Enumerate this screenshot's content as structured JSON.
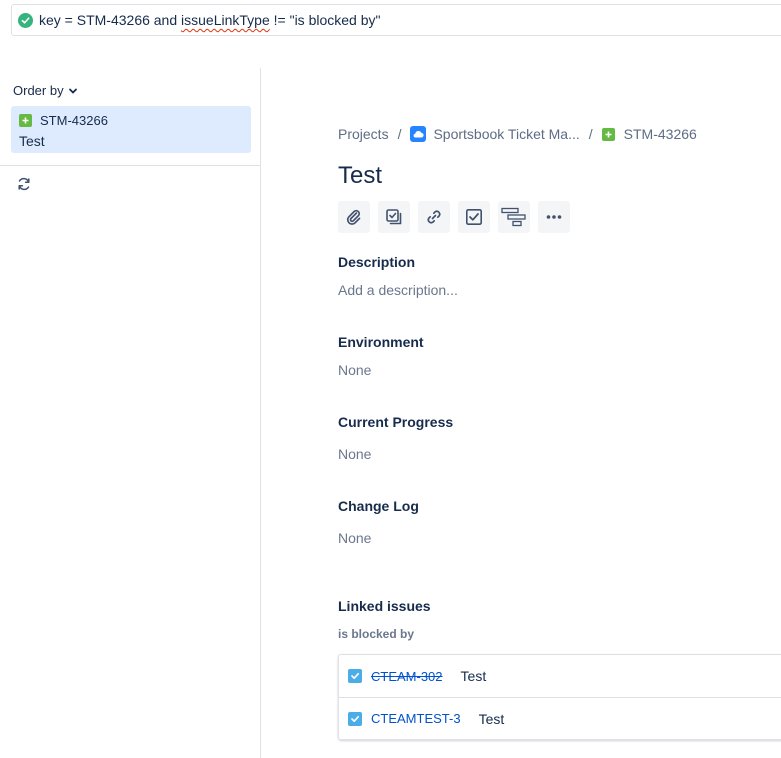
{
  "jql": {
    "prefix": "key = STM-43266 and ",
    "flagged_word": "issueLinkType",
    "suffix": " != \"is blocked by\"",
    "status": "valid",
    "status_color": "#36b37e"
  },
  "sidebar": {
    "order_by_label": "Order by",
    "issues": [
      {
        "key": "STM-43266",
        "summary": "Test",
        "type_icon": "story-icon",
        "selected": true
      }
    ],
    "refresh_icon": "refresh-icon"
  },
  "breadcrumb": {
    "projects": "Projects",
    "separator": "/",
    "project_name": "Sportsbook Ticket Ma...",
    "issue_key": "STM-43266"
  },
  "issue": {
    "title": "Test",
    "toolbar_icons": [
      "attachment-icon",
      "child-issue-icon",
      "link-icon",
      "checklist-icon",
      "roadmap-icon",
      "more-icon"
    ]
  },
  "fields": {
    "description": {
      "label": "Description",
      "placeholder": "Add a description..."
    },
    "environment": {
      "label": "Environment",
      "value": "None"
    },
    "current_progress": {
      "label": "Current Progress",
      "value": "None"
    },
    "change_log": {
      "label": "Change Log",
      "value": "None"
    }
  },
  "linked_issues": {
    "label": "Linked issues",
    "relation": "is blocked by",
    "items": [
      {
        "key": "CTEAM-302",
        "summary": "Test",
        "resolved": true
      },
      {
        "key": "CTEAMTEST-3",
        "summary": "Test",
        "resolved": false
      }
    ]
  },
  "colors": {
    "selected_card": "#deebff",
    "story": "#65ba43",
    "task": "#4bade8",
    "link": "#0052cc",
    "project": "#2684ff"
  }
}
